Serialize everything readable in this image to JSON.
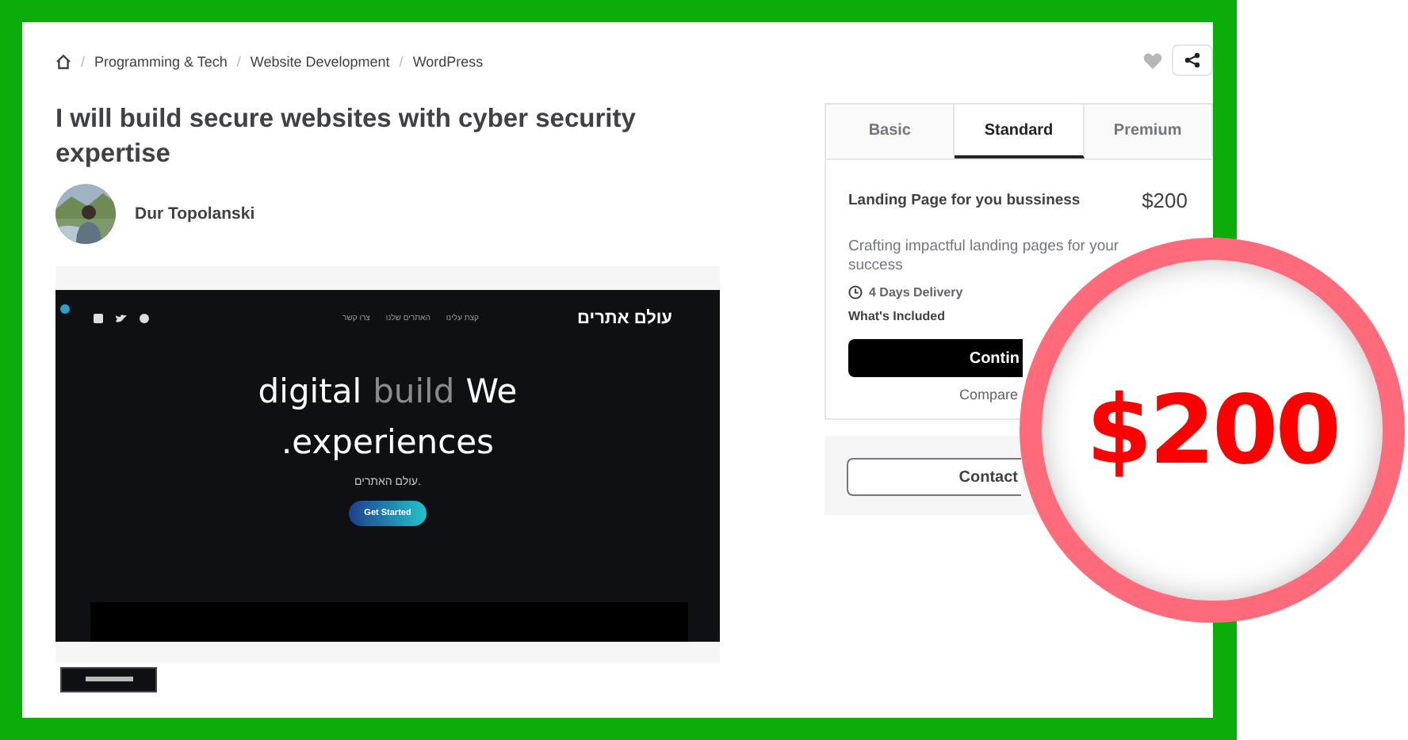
{
  "breadcrumb": [
    {
      "separator": "/",
      "label": "Programming & Tech"
    },
    {
      "separator": "/",
      "label": "Website Development"
    },
    {
      "separator": "/",
      "label": "WordPress"
    }
  ],
  "gig_title": "I will build secure websites with cyber security expertise",
  "seller": {
    "name": "Dur Topolanski"
  },
  "gallery": {
    "site": {
      "logo": "עולם אתרים",
      "nav": [
        "קצת עלינו",
        "האתרים שלנו",
        "צרו קשר"
      ],
      "hero_words": [
        {
          "text": "digital",
          "muted": false
        },
        {
          "text": "build",
          "muted": true
        },
        {
          "text": "We",
          "muted": false
        }
      ],
      "hero_line2": ".experiences",
      "subtitle": "עולם האתרים.",
      "cta": "Get Started"
    }
  },
  "packages": {
    "tabs": [
      {
        "label": "Basic",
        "selected": false
      },
      {
        "label": "Standard",
        "selected": true
      },
      {
        "label": "Premium",
        "selected": false
      }
    ],
    "name": "Landing Page for you bussiness",
    "price": "$200",
    "description": "Crafting impactful landing pages for your success",
    "delivery": "4 Days Delivery",
    "included": "What's Included",
    "continue": "Contin",
    "compare": "Compare"
  },
  "contact": "Contact",
  "price_badge": "$200"
}
